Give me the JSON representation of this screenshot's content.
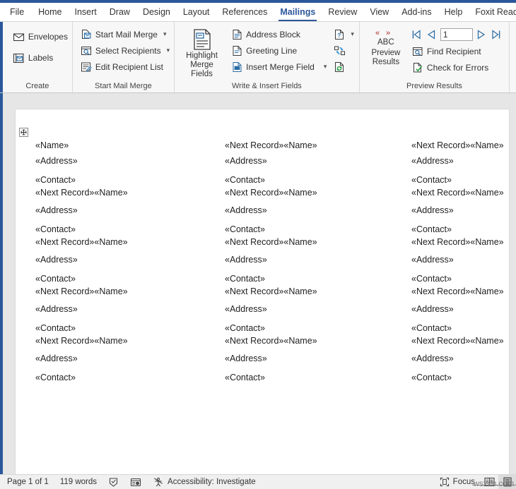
{
  "app": {
    "accent": "#2b579a",
    "ribbon_bg": "#f7f7f7",
    "doc_bg": "#e6e6e6"
  },
  "tabs": [
    {
      "label": "File",
      "active": false
    },
    {
      "label": "Home",
      "active": false
    },
    {
      "label": "Insert",
      "active": false
    },
    {
      "label": "Draw",
      "active": false
    },
    {
      "label": "Design",
      "active": false
    },
    {
      "label": "Layout",
      "active": false
    },
    {
      "label": "References",
      "active": false
    },
    {
      "label": "Mailings",
      "active": true
    },
    {
      "label": "Review",
      "active": false
    },
    {
      "label": "View",
      "active": false
    },
    {
      "label": "Add-ins",
      "active": false
    },
    {
      "label": "Help",
      "active": false
    },
    {
      "label": "Foxit Reader PDF",
      "active": false
    }
  ],
  "ribbon": {
    "groups": [
      {
        "name": "create",
        "label": "Create",
        "buttons": [
          {
            "label": "Envelopes",
            "icon": "envelope-icon"
          },
          {
            "label": "Labels",
            "icon": "labels-icon"
          }
        ]
      },
      {
        "name": "start-mail-merge",
        "label": "Start Mail Merge",
        "buttons": [
          {
            "label": "Start Mail Merge",
            "icon": "start-mail-merge-icon",
            "dropdown": true
          },
          {
            "label": "Select Recipients",
            "icon": "select-recipients-icon",
            "dropdown": true
          },
          {
            "label": "Edit Recipient List",
            "icon": "edit-recipient-list-icon",
            "dropdown": false
          }
        ]
      },
      {
        "name": "write-insert-fields",
        "label": "Write & Insert Fields",
        "highlight": {
          "label_line1": "Highlight",
          "label_line2": "Merge Fields",
          "icon": "highlight-merge-fields-icon"
        },
        "buttons": [
          {
            "label": "Address Block",
            "icon": "address-block-icon",
            "dropdown": false
          },
          {
            "label": "Greeting Line",
            "icon": "greeting-line-icon",
            "dropdown": false
          },
          {
            "label": "Insert Merge Field",
            "icon": "insert-merge-field-icon",
            "dropdown": true
          }
        ],
        "side_buttons": [
          {
            "name": "rules-button",
            "icon": "rules-icon",
            "dropdown": true
          },
          {
            "name": "match-fields-button",
            "icon": "match-fields-icon",
            "dropdown": false
          },
          {
            "name": "update-labels-button",
            "icon": "update-labels-icon",
            "dropdown": false
          }
        ]
      },
      {
        "name": "preview-results",
        "label": "Preview Results",
        "preview": {
          "glyph": "« »",
          "abc": "ABC",
          "label_line1": "Preview",
          "label_line2": "Results"
        },
        "record_value": "1",
        "nav": [
          {
            "name": "first-record-button",
            "icon": "first-record-icon"
          },
          {
            "name": "previous-record-button",
            "icon": "previous-record-icon"
          },
          {
            "name": "next-record-button",
            "icon": "next-record-icon"
          },
          {
            "name": "last-record-button",
            "icon": "last-record-icon"
          }
        ],
        "buttons": [
          {
            "label": "Find Recipient",
            "icon": "find-recipient-icon"
          },
          {
            "label": "Check for Errors",
            "icon": "check-for-errors-icon"
          }
        ]
      }
    ]
  },
  "document": {
    "fields": {
      "name": "«Name»",
      "next_record_name": "«Next Record»«Name»",
      "address": "«Address»",
      "contact": "«Contact»"
    },
    "rows": [
      {
        "c1": "«Name»",
        "c2": "«Next Record»«Name»",
        "c3": "«Next Record»«Name»",
        "gap": 22
      },
      {
        "c1": "«Address»",
        "c2": "«Address»",
        "c3": "«Address»",
        "gap": 27
      },
      {
        "c1": "«Contact»",
        "c2": "«Contact»",
        "c3": "«Contact»",
        "gap": 18
      },
      {
        "c1": "«Next Record»«Name»",
        "c2": "«Next Record»«Name»",
        "c3": "«Next Record»«Name»",
        "gap": 25
      },
      {
        "c1": "«Address»",
        "c2": "«Address»",
        "c3": "«Address»",
        "gap": 27
      },
      {
        "c1": "«Contact»",
        "c2": "«Contact»",
        "c3": "«Contact»",
        "gap": 18
      },
      {
        "c1": "«Next Record»«Name»",
        "c2": "«Next Record»«Name»",
        "c3": "«Next Record»«Name»",
        "gap": 25
      },
      {
        "c1": "«Address»",
        "c2": "«Address»",
        "c3": "«Address»",
        "gap": 27
      },
      {
        "c1": "«Contact»",
        "c2": "«Contact»",
        "c3": "«Contact»",
        "gap": 18
      },
      {
        "c1": "«Next Record»«Name»",
        "c2": "«Next Record»«Name»",
        "c3": "«Next Record»«Name»",
        "gap": 25
      },
      {
        "c1": "«Address»",
        "c2": "«Address»",
        "c3": "«Address»",
        "gap": 27
      },
      {
        "c1": "«Contact»",
        "c2": "«Contact»",
        "c3": "«Contact»",
        "gap": 18
      },
      {
        "c1": "«Next Record»«Name»",
        "c2": "«Next Record»«Name»",
        "c3": "«Next Record»«Name»",
        "gap": 25
      },
      {
        "c1": "«Address»",
        "c2": "«Address»",
        "c3": "«Address»",
        "gap": 27
      },
      {
        "c1": "«Contact»",
        "c2": "«Contact»",
        "c3": "«Contact»",
        "gap": 18
      }
    ]
  },
  "statusbar": {
    "page": "Page 1 of 1",
    "words": "119 words",
    "proofing_icon": "proofing-icon",
    "read_aloud_icon": "read-aloud-icon",
    "accessibility_icon": "accessibility-icon",
    "accessibility": "Accessibility: Investigate",
    "focus": "Focus",
    "focus_icon": "focus-icon",
    "views": [
      {
        "name": "read-mode-view-button",
        "icon": "read-mode-icon",
        "active": false
      },
      {
        "name": "print-layout-view-button",
        "icon": "print-layout-icon",
        "active": true
      }
    ],
    "watermark": "wsxdn.com"
  }
}
